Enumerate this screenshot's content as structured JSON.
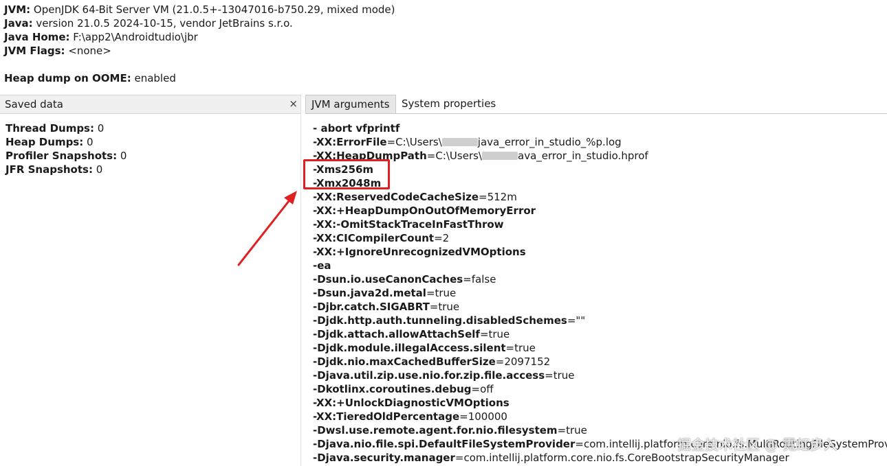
{
  "info": {
    "jvm_label": "JVM:",
    "jvm_value": " OpenJDK 64-Bit Server VM (21.0.5+-13047016-b750.29, mixed mode)",
    "java_label": "Java:",
    "java_value": " version 21.0.5 2024-10-15, vendor JetBrains s.r.o.",
    "home_label": "Java Home:",
    "home_value": " F:\\app2\\Androidtudio\\jbr",
    "flags_label": "JVM Flags:",
    "flags_value": " <none>",
    "heap_label": "Heap dump on OOME:",
    "heap_value": " enabled"
  },
  "left_panel": {
    "title": "Saved data",
    "close_glyph": "×",
    "stats": [
      {
        "label": "Thread Dumps:",
        "value": " 0"
      },
      {
        "label": "Heap Dumps:",
        "value": " 0"
      },
      {
        "label": "Profiler Snapshots:",
        "value": " 0"
      },
      {
        "label": "JFR Snapshots:",
        "value": " 0"
      }
    ]
  },
  "tabs": [
    {
      "label": "JVM arguments",
      "active": true
    },
    {
      "label": "System properties",
      "active": false
    }
  ],
  "args": [
    {
      "key": "- abort vfprintf",
      "val": ""
    },
    {
      "key": "-XX:ErrorFile",
      "val": "=C:\\Users\\",
      "redacted": true,
      "val2": "java_error_in_studio_%p.log"
    },
    {
      "key": "-XX:HeapDumpPath",
      "val": "=C:\\Users\\",
      "redacted": true,
      "val2": "ava_error_in_studio.hprof"
    },
    {
      "key": "-Xms256m",
      "val": ""
    },
    {
      "key": "-Xmx2048m",
      "val": ""
    },
    {
      "key": "-XX:ReservedCodeCacheSize",
      "val": "=512m"
    },
    {
      "key": "-XX:+HeapDumpOnOutOfMemoryError",
      "val": ""
    },
    {
      "key": "-XX:-OmitStackTraceInFastThrow",
      "val": ""
    },
    {
      "key": "-XX:CICompilerCount",
      "val": "=2"
    },
    {
      "key": "-XX:+IgnoreUnrecognizedVMOptions",
      "val": ""
    },
    {
      "key": "-ea",
      "val": ""
    },
    {
      "key": "-Dsun.io.useCanonCaches",
      "val": "=false"
    },
    {
      "key": "-Dsun.java2d.metal",
      "val": "=true"
    },
    {
      "key": "-Djbr.catch.SIGABRT",
      "val": "=true"
    },
    {
      "key": "-Djdk.http.auth.tunneling.disabledSchemes",
      "val": "=\"\""
    },
    {
      "key": "-Djdk.attach.allowAttachSelf",
      "val": "=true"
    },
    {
      "key": "-Djdk.module.illegalAccess.silent",
      "val": "=true"
    },
    {
      "key": "-Djdk.nio.maxCachedBufferSize",
      "val": "=2097152"
    },
    {
      "key": "-Djava.util.zip.use.nio.for.zip.file.access",
      "val": "=true"
    },
    {
      "key": "-Dkotlinx.coroutines.debug",
      "val": "=off"
    },
    {
      "key": "-XX:+UnlockDiagnosticVMOptions",
      "val": ""
    },
    {
      "key": "-XX:TieredOldPercentage",
      "val": "=100000"
    },
    {
      "key": "-Dwsl.use.remote.agent.for.nio.filesystem",
      "val": "=true"
    },
    {
      "key": "-Djava.nio.file.spi.DefaultFileSystemProvider",
      "val": "=com.intellij.platform.core.nio.fs.MultiRoutingFileSystemProvider"
    },
    {
      "key": "-Djava.security.manager",
      "val": "=com.intellij.platform.core.nio.fs.CoreBootstrapSecurityManager"
    }
  ],
  "annotation": {
    "color": "#e02020"
  },
  "watermark": "掘金技术社区 @ 霓虹步入"
}
